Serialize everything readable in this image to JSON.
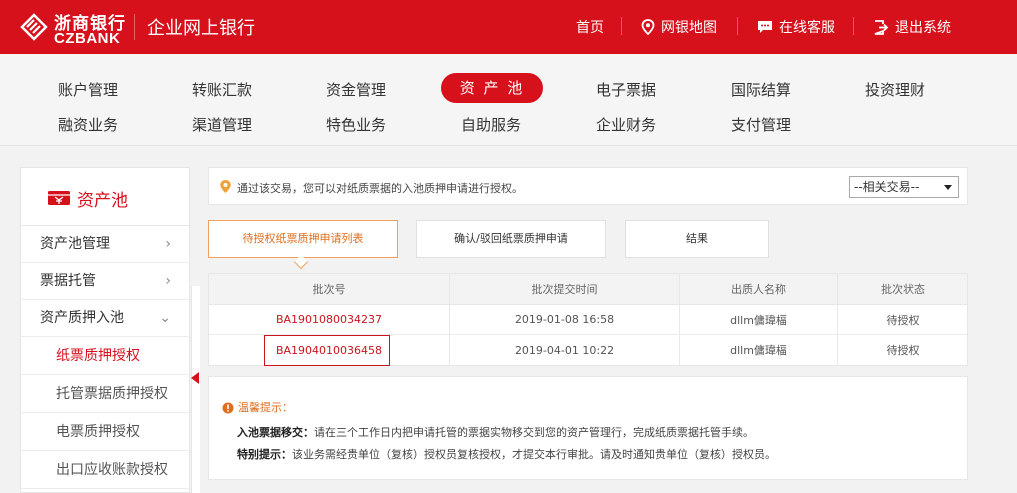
{
  "header": {
    "logo_cn": "浙商银行",
    "logo_en": "CZBANK",
    "app_title": "企业网上银行",
    "links": {
      "home": "首页",
      "map": "网银地图",
      "service": "在线客服",
      "logout": "退出系统"
    }
  },
  "nav": {
    "row1": [
      "账户管理",
      "转账汇款",
      "资金管理",
      "资 产 池",
      "电子票据",
      "国际结算",
      "投资理财"
    ],
    "row2": [
      "融资业务",
      "渠道管理",
      "特色业务",
      "自助服务",
      "企业财务",
      "支付管理"
    ],
    "active_index": 3
  },
  "sidebar": {
    "title": "资产池",
    "items": [
      "资产池管理",
      "票据托管",
      "资产质押入池"
    ],
    "chevrons": [
      "›",
      "›",
      "⌄"
    ],
    "subitems": [
      "纸票质押授权",
      "托管票据质押授权",
      "电票质押授权",
      "出口应收账款授权"
    ],
    "active_sub": 0
  },
  "notice": {
    "text": "通过该交易，您可以对纸质票据的入池质押申请进行授权。",
    "select_value": "--相关交易--"
  },
  "tabs": [
    "待授权纸票质押申请列表",
    "确认/驳回纸票质押申请",
    "结果"
  ],
  "table": {
    "headers": [
      "批次号",
      "批次提交时间",
      "出质人名称",
      "批次状态"
    ],
    "rows": [
      [
        "BA1901080034237",
        "2019-01-08 16:58",
        "dllm傭瑋楅",
        "待授权"
      ],
      [
        "BA1904010036458",
        "2019-04-01 10:22",
        "dllm傭瑋楅",
        "待授权"
      ]
    ]
  },
  "tips": {
    "title": "温馨提示：",
    "line1_label": "入池票据移交：",
    "line1_text": "请在三个工作日内把申请托管的票据实物移交到您的资产管理行，完成纸质票据托管手续。",
    "line2_label": "特别提示：",
    "line2_text": "该业务需经贵单位（复核）授权员复核授权，才提交本行审批。请及时通知贵单位（复核）授权员。"
  },
  "colors": {
    "brand_red": "#d7111c",
    "accent_orange": "#e06d1e"
  },
  "icons": [
    "logo-icon",
    "map-pin-icon",
    "chat-icon",
    "logout-icon",
    "asset-pool-icon",
    "info-icon",
    "chevron-right-icon",
    "chevron-down-icon",
    "warning-icon",
    "dropdown-caret-icon"
  ]
}
